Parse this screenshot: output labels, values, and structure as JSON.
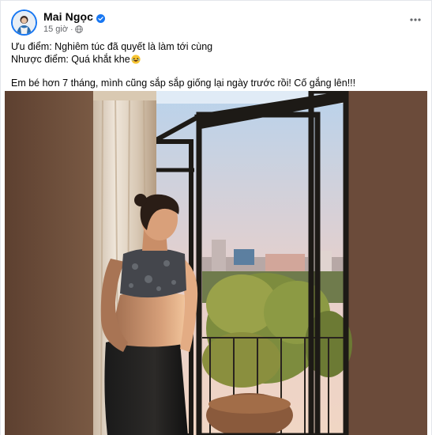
{
  "post": {
    "author": {
      "name": "Mai Ngọc",
      "verified": true
    },
    "time": "15 giờ",
    "meta_separator": "·",
    "privacy_icon": "globe-icon",
    "more_icon": "more-horizontal-icon",
    "lines": [
      "Ưu điểm: Nghiêm túc đã quyết là làm tới cùng",
      "Nhược điểm: Quá khắt khe",
      "Em bé hơn 7 tháng, mình cũng sắp sắp giống lại ngày trước rồi! Cố gắng lên!!!"
    ],
    "emoji": "laughing-face-icon"
  },
  "colors": {
    "brand": "#1877f2",
    "secondary_text": "#65676b",
    "photo_wall": "#6a4a3a"
  }
}
